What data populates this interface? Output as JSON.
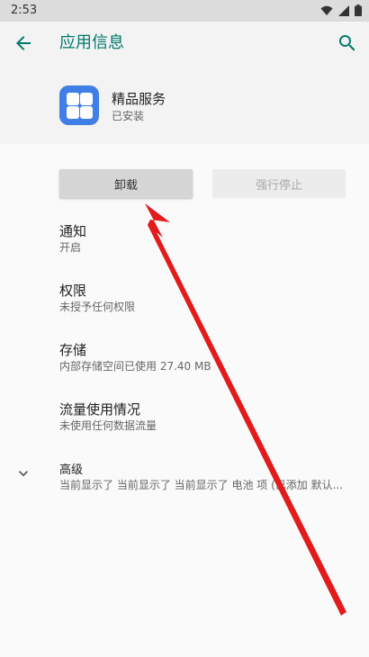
{
  "status_bar": {
    "time": "2:53",
    "icons": [
      "wifi-icon",
      "cellular-icon",
      "battery-icon"
    ]
  },
  "app_bar": {
    "title": "应用信息",
    "back_icon": "arrow-back-icon",
    "search_icon": "search-icon",
    "title_color": "#00796b"
  },
  "app": {
    "name": "精品服务",
    "status": "已安装",
    "icon_color": "#3f7fe6"
  },
  "buttons": {
    "uninstall": "卸载",
    "force_stop": "强行停止"
  },
  "settings": [
    {
      "title": "通知",
      "subtitle": "开启"
    },
    {
      "title": "权限",
      "subtitle": "未授予任何权限"
    },
    {
      "title": "存储",
      "subtitle": "内部存储空间已使用 27.40 MB"
    },
    {
      "title": "流量使用情况",
      "subtitle": "未使用任何数据流量"
    },
    {
      "title": "高级",
      "subtitle": "当前显示了 当前显示了 当前显示了 电池 项 (已添加 默认..."
    }
  ],
  "annotation": {
    "type": "red-arrow",
    "color": "#e21b1b",
    "points_to": "uninstall-button"
  }
}
